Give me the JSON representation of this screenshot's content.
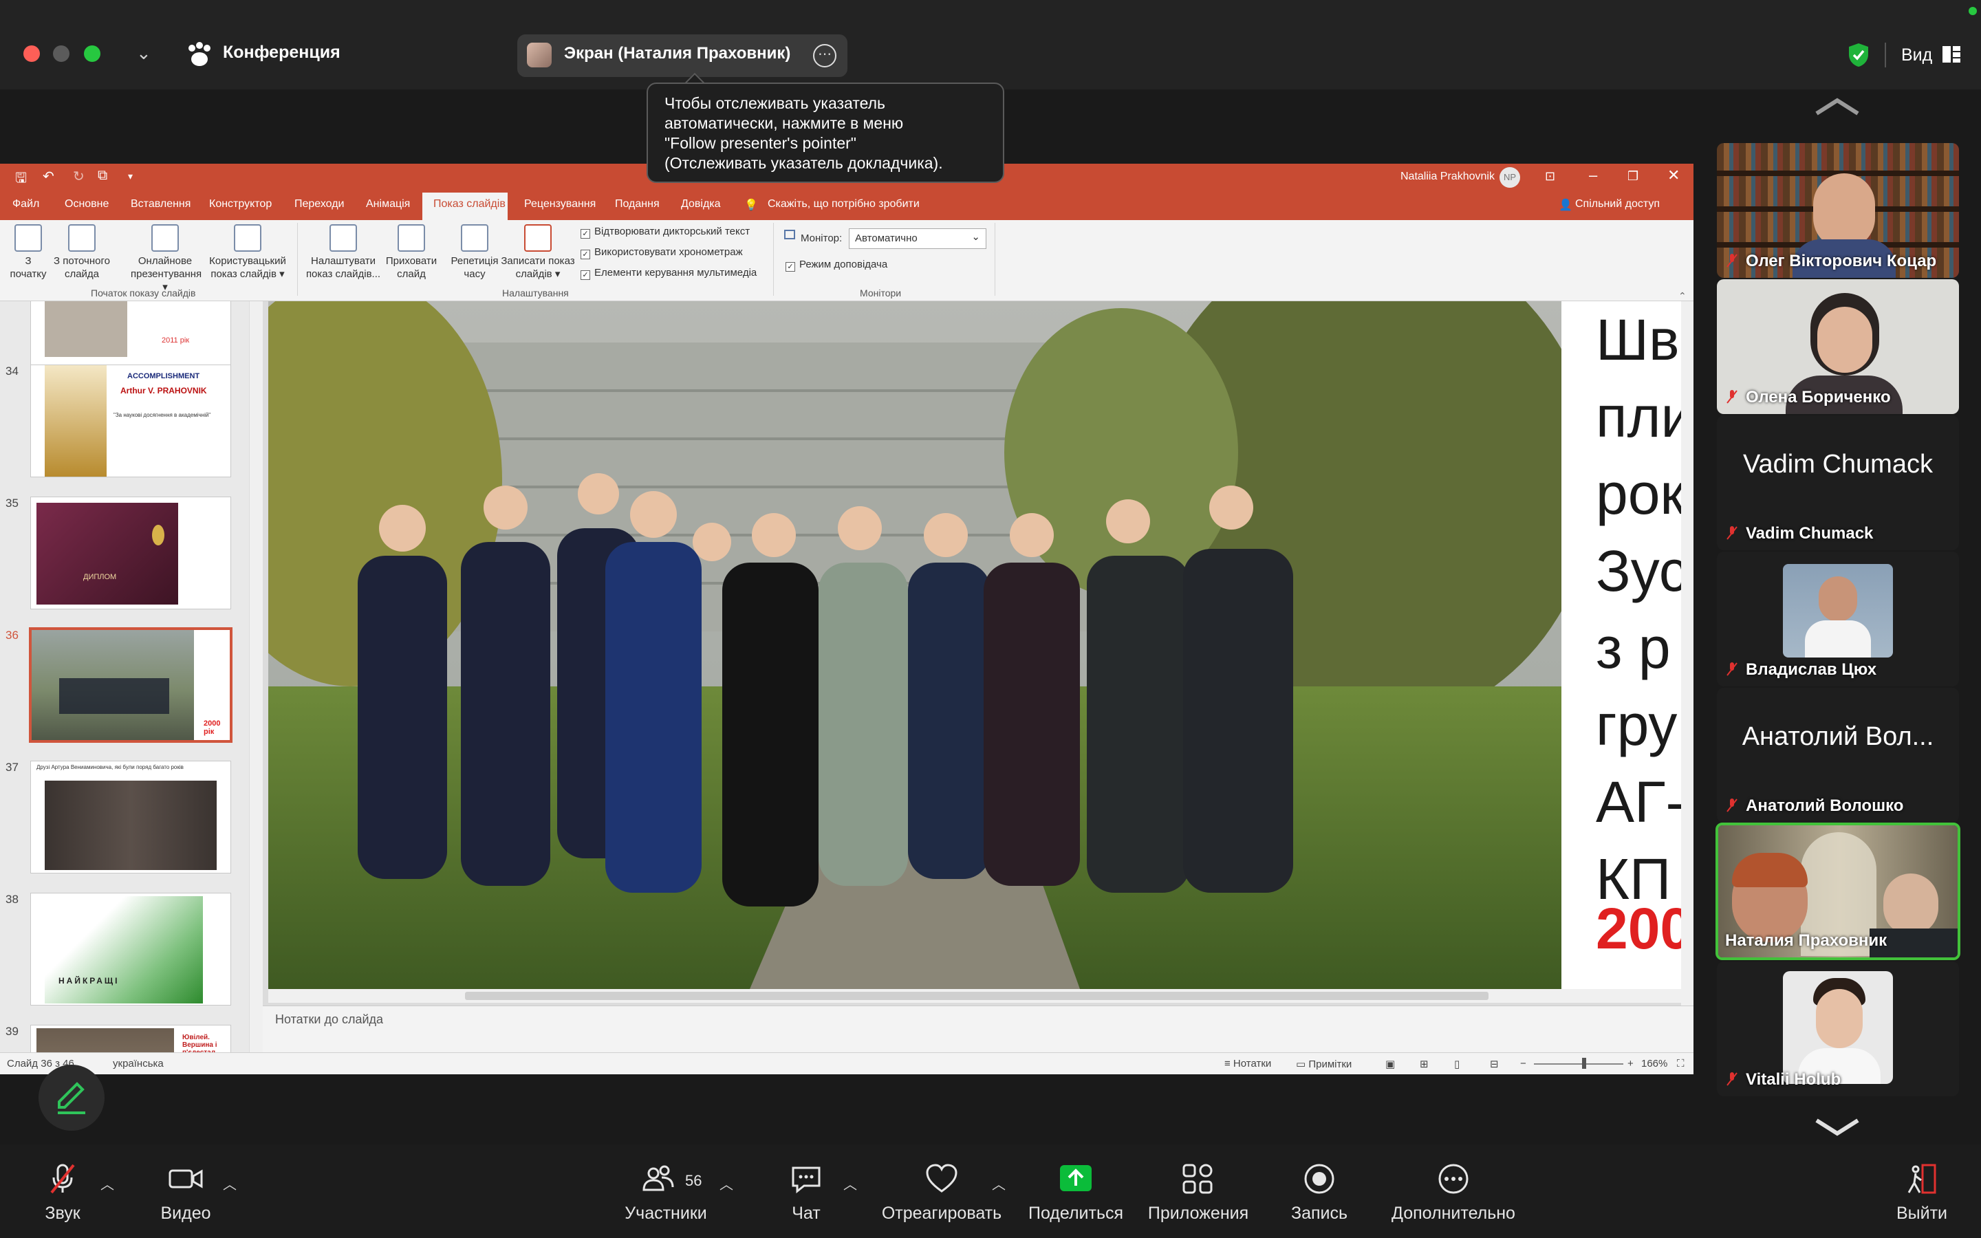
{
  "zoom": {
    "meeting_title": "Конференция",
    "share_title": "Экран (Наталия Праховник)",
    "view_label": "Вид",
    "tooltip": [
      "Чтобы отслеживать указатель",
      "автоматически, нажмите в меню",
      "\"Follow presenter's pointer\"",
      "(Отслеживать указатель докладчика)."
    ]
  },
  "ppt": {
    "user_name": "Nataliia Prakhovnik",
    "user_initials": "NP",
    "menu_tabs": [
      "Файл",
      "Основне",
      "Вставлення",
      "Конструктор",
      "Переходи",
      "Анімація",
      "Показ слайдів",
      "Рецензування",
      "Подання",
      "Довідка"
    ],
    "tell_me": "Скажіть, що потрібно зробити",
    "share": "Спільний доступ",
    "ribbon": {
      "from_start": [
        "З",
        "початку"
      ],
      "from_current": [
        "З поточного",
        "слайда"
      ],
      "online": [
        "Онлайнове",
        "презентування ▾"
      ],
      "custom": [
        "Користувацький",
        "показ слайдів ▾"
      ],
      "group_start": "Початок показу слайдів",
      "setup": [
        "Налаштувати",
        "показ слайдів..."
      ],
      "hide": [
        "Приховати",
        "слайд"
      ],
      "rehearse": [
        "Репетиція",
        "часу"
      ],
      "record": [
        "Записати показ",
        "слайдів ▾"
      ],
      "chk_narration": "Відтворювати дикторський текст",
      "chk_timings": "Використовувати хронометраж",
      "chk_media": "Елементи керування мультимедіа",
      "group_setup": "Налаштування",
      "monitor_label": "Монітор:",
      "monitor_value": "Автоматично",
      "presenter_view": "Режим доповідача",
      "group_monitors": "Монітори"
    },
    "thumbs": [
      {
        "num": "",
        "caption": "2011 рік"
      },
      {
        "num": "34",
        "title": "ACCOMPLISHMENT",
        "subtitle": "Arthur V. PRAHOVNIK",
        "caption": "\"За наукові досягнення в академічній\""
      },
      {
        "num": "35",
        "caption": "ДИПЛОМ"
      },
      {
        "num": "36",
        "caption": "2000 рік"
      },
      {
        "num": "37",
        "caption": "Друзі Артура Вениаминовича, які були поряд багато років"
      },
      {
        "num": "38",
        "caption": "НАЙКРАЩІ"
      },
      {
        "num": "39",
        "caption": "Ювілей. Вершина і п'єдестал."
      }
    ],
    "slide_lines": [
      "Шв",
      "пли",
      "рок",
      "Зус",
      "з р",
      "гру",
      "АГ-",
      "КП"
    ],
    "slide_year": "200",
    "notes_placeholder": "Нотатки до слайда",
    "status": {
      "slide": "Слайд 36 з 46",
      "language": "українська",
      "notes_btn": "Нотатки",
      "comments_btn": "Примітки",
      "zoom": "166%"
    }
  },
  "participants": [
    {
      "name": "Олег Вікторович Коцар",
      "type": "video",
      "bg": "#6b4a2e"
    },
    {
      "name": "Олена Бориченко",
      "type": "video",
      "bg": "#d9d9d6"
    },
    {
      "name": "Vadim Chumack",
      "big": "Vadim Chumack",
      "type": "name"
    },
    {
      "name": "Владислав Цюх",
      "type": "video",
      "bg": "#7d92a8"
    },
    {
      "name": "Анатолий Волошко",
      "big": "Анатолий Вол...",
      "type": "name"
    },
    {
      "name": "Наталия Праховник",
      "type": "video",
      "bg": "#8a8272",
      "active": true
    },
    {
      "name": "Vitalii Holub",
      "type": "video",
      "bg": "#e8e8e8"
    }
  ],
  "toolbar": {
    "audio": "Звук",
    "video": "Видео",
    "participants": "Участники",
    "participant_count": "56",
    "chat": "Чат",
    "react": "Отреагировать",
    "share": "Поделиться",
    "apps": "Приложения",
    "record": "Запись",
    "more": "Дополнительно",
    "leave": "Выйти"
  },
  "colors": {
    "ppt_accent": "#c84b33",
    "zoom_share_green": "#0bbc3a",
    "active_speaker": "#42c23a",
    "muted_red": "#e0312f",
    "slide_year_red": "#e02020"
  }
}
